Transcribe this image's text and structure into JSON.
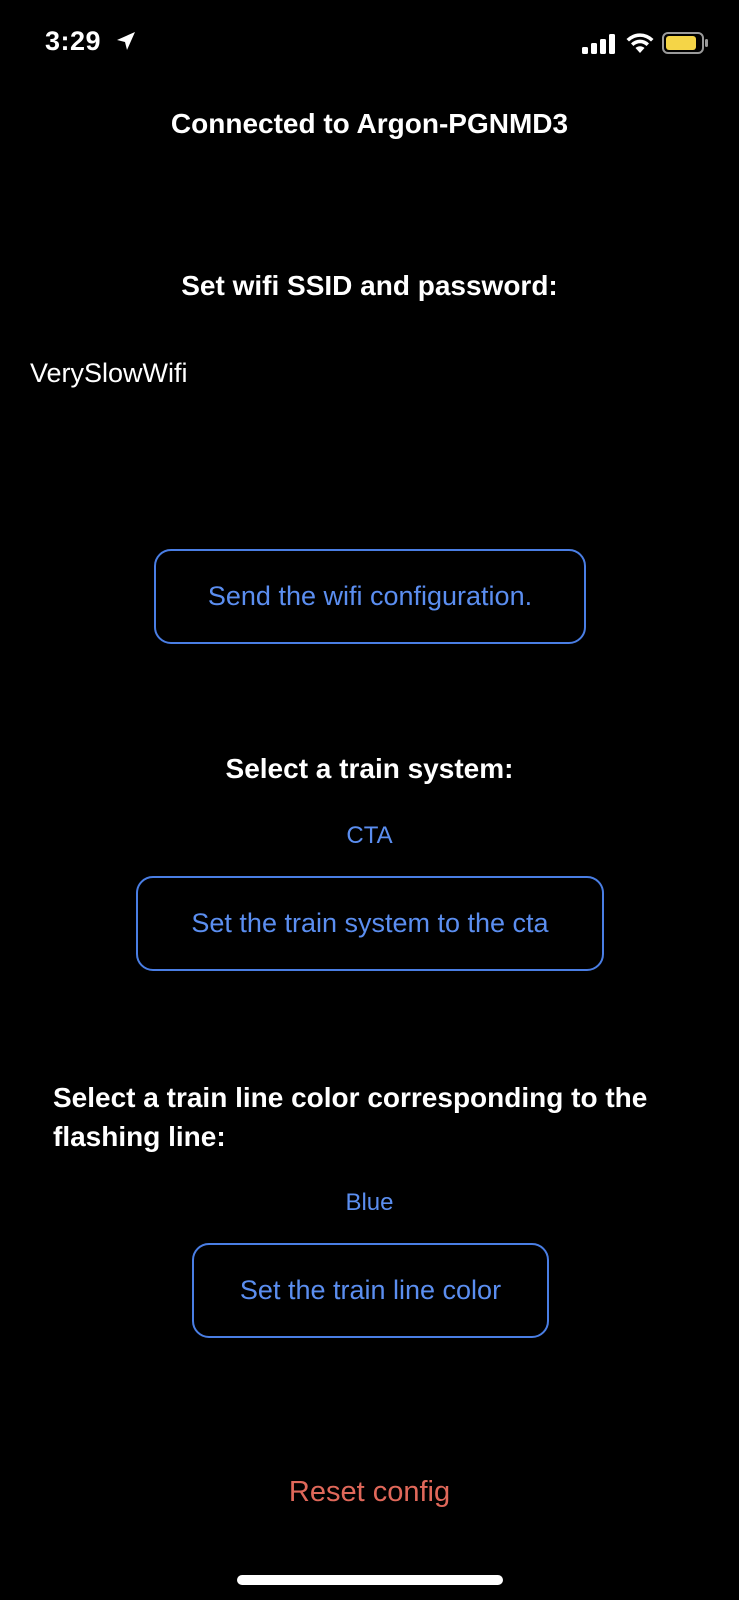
{
  "status_bar": {
    "time": "3:29",
    "icons": [
      "location-arrow-icon",
      "cellular-signal-icon",
      "wifi-icon",
      "battery-icon"
    ],
    "battery_color": "#f5d547"
  },
  "header": {
    "title": "Connected to Argon-PGNMD3"
  },
  "wifi_section": {
    "heading": "Set wifi SSID and password:",
    "ssid_value": "VerySlowWifi",
    "send_button_label": "Send the wifi configuration."
  },
  "train_system_section": {
    "heading": "Select a train system:",
    "selected_value": "CTA",
    "set_button_label": "Set the train system to the cta"
  },
  "train_line_section": {
    "heading": "Select a train line color corresponding to the flashing line:",
    "selected_value": "Blue",
    "set_button_label": "Set the train line color"
  },
  "footer": {
    "reset_label": "Reset config"
  },
  "colors": {
    "background": "#000000",
    "accent_blue": "#5b8ef0",
    "reset_red": "#e0685a"
  }
}
